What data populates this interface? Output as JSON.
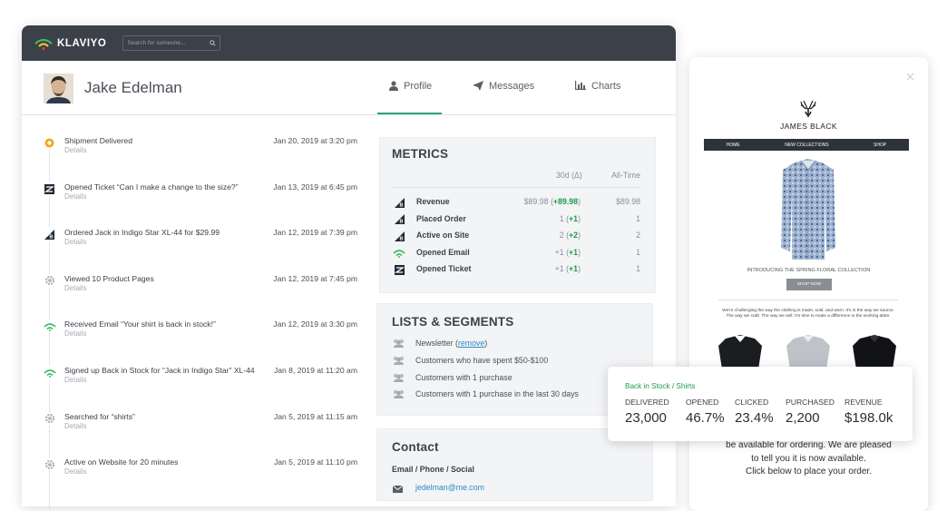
{
  "app": {
    "logo_text": "KLAVIYO",
    "search_placeholder": "Search for someone..."
  },
  "profile": {
    "name": "Jake Edelman"
  },
  "tabs": [
    {
      "label": "Profile"
    },
    {
      "label": "Messages"
    },
    {
      "label": "Charts"
    }
  ],
  "timeline": [
    {
      "title": "Shipment Delivered",
      "details": "Details",
      "date": "Jan 20, 2019 at 3:20 pm",
      "icon": "location-pin-icon"
    },
    {
      "title": "Opened Ticket “Can I make a change to the size?”",
      "details": "Details",
      "date": "Jan 13, 2019 at 6:45 pm",
      "icon": "zendesk-icon"
    },
    {
      "title": "Ordered Jack in Indigo Star XL-44 for $29.99",
      "details": "Details",
      "date": "Jan 12, 2019 at 7:39 pm",
      "icon": "bigcommerce-icon"
    },
    {
      "title": "Viewed 10 Product Pages",
      "details": "Details",
      "date": "Jan 12, 2019 at 7:45 pm",
      "icon": "gear-icon"
    },
    {
      "title": "Received Email “Your shirt is back in stock!”",
      "details": "Details",
      "date": "Jan 12, 2019 at 3:30 pm",
      "icon": "klaviyo-icon"
    },
    {
      "title": "Signed up Back in Stock for “Jack in Indigo Star” XL-44",
      "details": "Details",
      "date": "Jan 8, 2019 at 11:20 am",
      "icon": "klaviyo-icon"
    },
    {
      "title": "Searched for “shirts”",
      "details": "Details",
      "date": "Jan 5, 2019 at 11:15 am",
      "icon": "gear-icon"
    },
    {
      "title": "Active on Website for 20 minutes",
      "details": "Details",
      "date": "Jan 5, 2019 at 11:10 pm",
      "icon": "gear-icon"
    }
  ],
  "metrics": {
    "title": "METRICS",
    "col_30d": "30d (Δ)",
    "col_all": "All-Time",
    "rows": [
      {
        "name": "Revenue",
        "val30": "$89.98",
        "delta": "+89.98",
        "all": "$89.98",
        "icon": "bigcommerce-icon"
      },
      {
        "name": "Placed Order",
        "val30": "1",
        "delta": "+1",
        "all": "1",
        "icon": "bigcommerce-icon"
      },
      {
        "name": "Active on Site",
        "val30": "2",
        "delta": "+2",
        "all": "2",
        "icon": "bigcommerce-icon"
      },
      {
        "name": "Opened Email",
        "val30": "+1",
        "delta": "+1",
        "all": "1",
        "icon": "klaviyo-icon"
      },
      {
        "name": "Opened Ticket",
        "val30": "+1",
        "delta": "+1",
        "all": "1",
        "icon": "zendesk-icon"
      }
    ]
  },
  "lists": {
    "title": "LISTS & SEGMENTS",
    "newsletter": "Newsletter",
    "remove": "remove",
    "items": [
      "Customers who have spent $50-$100",
      "Customers with 1 purchase",
      "Customers with 1 purchase in the last 30 days"
    ]
  },
  "contact": {
    "title": "Contact",
    "subtitle": "Email / Phone / Social",
    "email": "jedelman@me.com"
  },
  "email_preview": {
    "brand": "JAMES BLACK",
    "nav": [
      "HOME",
      "NEW COLLECTIONS",
      "SHOP"
    ],
    "caption": "INTRODUCING THE SPRING FLORAL COLLECTION",
    "button": "SHOP NOW",
    "body_small": "We're challenging the way the clothing is made, sold, and worn. It's in the way we source. The way we craft. The way we sell. It's time to make a difference in the working attire.",
    "body_text": [
      "be available for ordering. We are pleased",
      "to tell you it is now available.",
      "Click below to place your order."
    ]
  },
  "popup": {
    "title": "Back in Stock / Shirts",
    "stats": [
      {
        "label": "DELIVERED",
        "value": "23,000"
      },
      {
        "label": "OPENED",
        "value": "46.7%"
      },
      {
        "label": "CLICKED",
        "value": "23.4%"
      },
      {
        "label": "PURCHASED",
        "value": "2,200"
      },
      {
        "label": "REVENUE",
        "value": "$198.0k"
      }
    ]
  },
  "colors": {
    "topbar": "#3b4049",
    "accent_green": "#2aa47e",
    "positive": "#1e9b4a",
    "link": "#2a8cc7"
  }
}
